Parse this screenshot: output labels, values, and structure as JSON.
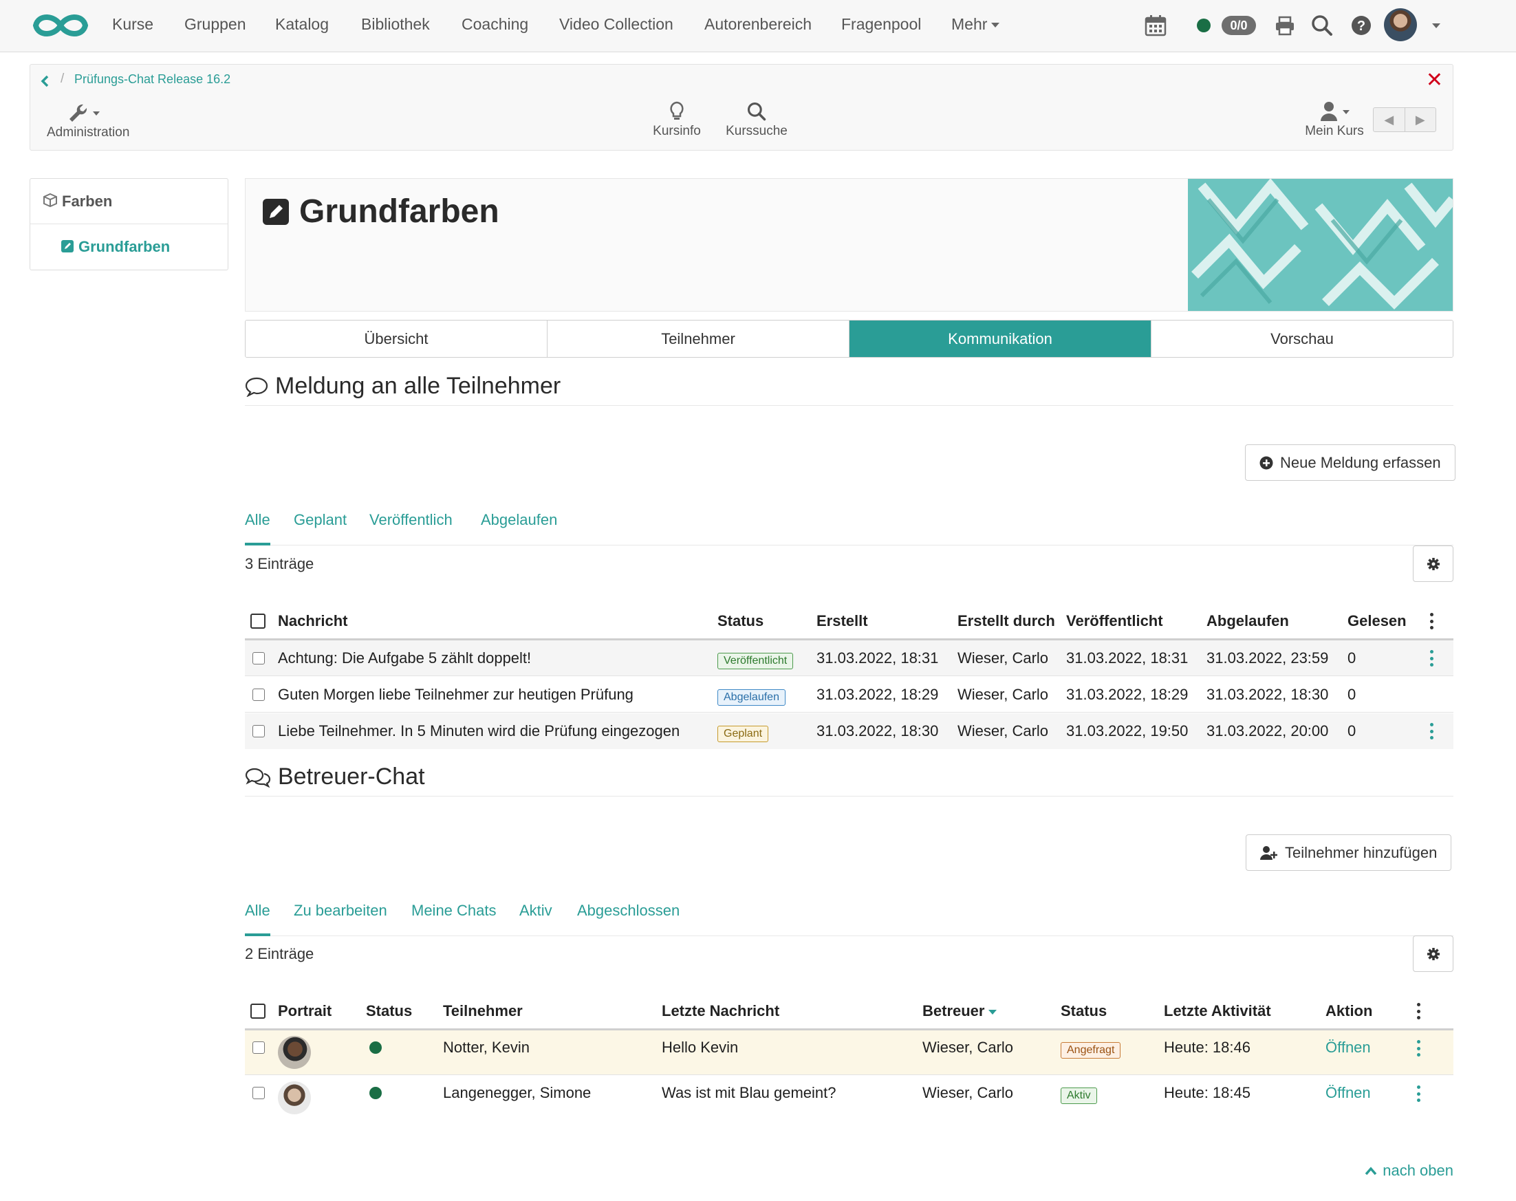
{
  "nav": {
    "items": [
      "Kurse",
      "Gruppen",
      "Katalog",
      "Bibliothek",
      "Coaching",
      "Video Collection",
      "Autorenbereich",
      "Fragenpool",
      "Mehr"
    ],
    "count_badge": "0/0",
    "icons": [
      "calendar-icon",
      "presence-dot",
      "print-icon",
      "search-icon",
      "help-icon",
      "avatar"
    ]
  },
  "course_toolbar": {
    "breadcrumb": "Prüfungs-Chat Release 16.2",
    "administration": "Administration",
    "kursinfo": "Kursinfo",
    "kurssuche": "Kurssuche",
    "mein_kurs": "Mein Kurs"
  },
  "left_menu": {
    "root": "Farben",
    "child": "Grundfarben"
  },
  "header": {
    "title": "Grundfarben"
  },
  "tabs": [
    "Übersicht",
    "Teilnehmer",
    "Kommunikation",
    "Vorschau"
  ],
  "announcements": {
    "title": "Meldung an alle Teilnehmer",
    "new_button": "Neue Meldung erfassen",
    "filters": [
      "Alle",
      "Geplant",
      "Veröffentlich",
      "Abgelaufen"
    ],
    "entries": "3 Einträge",
    "columns": [
      "Nachricht",
      "Status",
      "Erstellt",
      "Erstellt durch",
      "Veröffentlicht",
      "Abgelaufen",
      "Gelesen"
    ],
    "rows": [
      {
        "message": "Achtung: Die Aufgabe 5 zählt doppelt!",
        "status": "Veröffentlicht",
        "created": "31.03.2022, 18:31",
        "by": "Wieser, Carlo",
        "published": "31.03.2022, 18:31",
        "expired": "31.03.2022, 23:59",
        "read": "0"
      },
      {
        "message": "Guten Morgen liebe Teilnehmer zur heutigen Prüfung",
        "status": "Abgelaufen",
        "created": "31.03.2022, 18:29",
        "by": "Wieser, Carlo",
        "published": "31.03.2022, 18:29",
        "expired": "31.03.2022, 18:30",
        "read": "0"
      },
      {
        "message": "Liebe Teilnehmer. In 5 Minuten wird die Prüfung eingezogen",
        "status": "Geplant",
        "created": "31.03.2022, 18:30",
        "by": "Wieser, Carlo",
        "published": "31.03.2022, 19:50",
        "expired": "31.03.2022, 20:00",
        "read": "0"
      }
    ]
  },
  "chat": {
    "title": "Betreuer-Chat",
    "add_button": "Teilnehmer hinzufügen",
    "filters": [
      "Alle",
      "Zu bearbeiten",
      "Meine Chats",
      "Aktiv",
      "Abgeschlossen"
    ],
    "entries": "2 Einträge",
    "columns": [
      "Portrait",
      "Status",
      "Teilnehmer",
      "Letzte Nachricht",
      "Betreuer",
      "Status",
      "Letzte Aktivität",
      "Aktion"
    ],
    "rows": [
      {
        "participant": "Notter, Kevin",
        "last_message": "Hello Kevin",
        "coach": "Wieser, Carlo",
        "status": "Angefragt",
        "activity": "Heute: 18:46",
        "action": "Öffnen"
      },
      {
        "participant": "Langenegger, Simone",
        "last_message": "Was ist mit Blau gemeint?",
        "coach": "Wieser, Carlo",
        "status": "Aktiv",
        "activity": "Heute: 18:45",
        "action": "Öffnen"
      }
    ]
  },
  "footer": {
    "to_top": "nach oben"
  },
  "colors": {
    "accent": "#2a9d96",
    "online": "#1a6e45",
    "close": "#d0021b"
  }
}
